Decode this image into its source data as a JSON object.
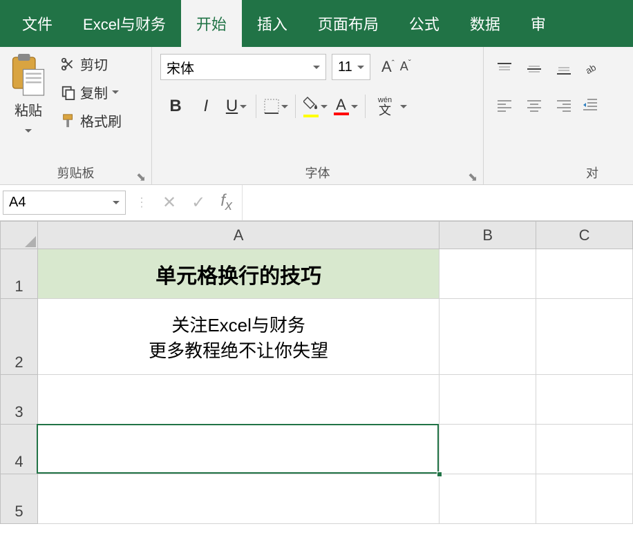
{
  "menu": {
    "items": [
      "文件",
      "Excel与财务",
      "开始",
      "插入",
      "页面布局",
      "公式",
      "数据",
      "审"
    ],
    "activeIndex": 2
  },
  "ribbon": {
    "clipboard": {
      "paste": "粘贴",
      "cut": "剪切",
      "copy": "复制",
      "formatPainter": "格式刷",
      "label": "剪贴板"
    },
    "font": {
      "name": "宋体",
      "size": "11",
      "label": "字体",
      "bold": "B",
      "italic": "I",
      "underline": "U",
      "fontColorLetter": "A",
      "wenTop": "wén",
      "wenBot": "文"
    },
    "alignment": {
      "label": "对"
    }
  },
  "namebox": "A4",
  "formula": "",
  "columns": [
    "A",
    "B",
    "C"
  ],
  "rows": [
    "1",
    "2",
    "3",
    "4",
    "5"
  ],
  "cells": {
    "A1": "单元格换行的技巧",
    "A2_line1": "关注Excel与财务",
    "A2_line2": "更多教程绝不让你失望"
  },
  "selection": {
    "cell": "A4"
  }
}
